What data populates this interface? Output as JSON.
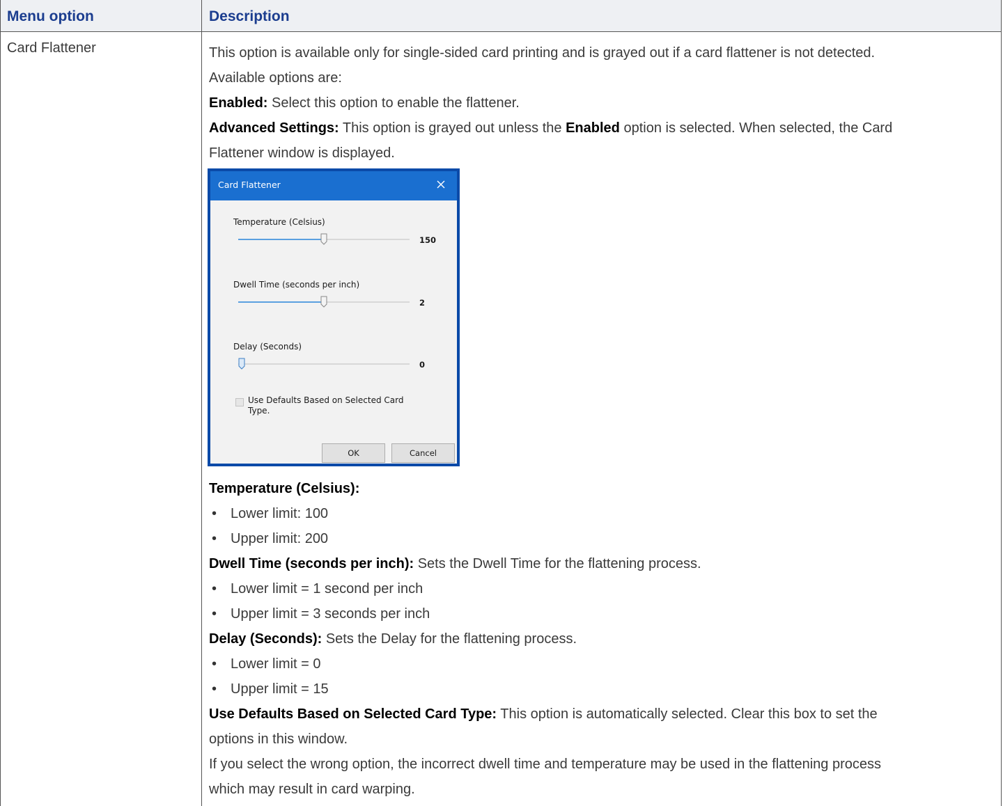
{
  "table": {
    "headers": [
      "Menu option",
      "Description"
    ],
    "row": {
      "option": "Card Flattener",
      "intro_1": "This option is available only for single-sided card printing and is grayed out if a card flattener is not detected.",
      "intro_2": "Available options are:",
      "enabled_term": "Enabled:",
      "enabled_text": " Select this option to enable the flattener.",
      "adv_term": "Advanced Settings:",
      "adv_text_1": " This option is grayed out unless the ",
      "adv_text_em": "Enabled",
      "adv_text_2": " option is selected. When selected, the Card",
      "adv_text_3": "Flattener window is displayed.",
      "temp_term": "Temperature (Celsius):",
      "temp_bullets": [
        "Lower limit: 100",
        "Upper limit: 200"
      ],
      "dwell_term": "Dwell Time (seconds per inch):",
      "dwell_text": " Sets the Dwell Time for the flattening process.",
      "dwell_bullets": [
        "Lower limit = 1 second per inch",
        "Upper limit = 3 seconds per inch"
      ],
      "delay_term": "Delay (Seconds):",
      "delay_text": " Sets the Delay for the flattening process.",
      "delay_bullets": [
        "Lower limit = 0",
        "Upper limit = 15"
      ],
      "defaults_term": "Use Defaults Based on Selected Card Type:",
      "defaults_text_1": " This option is automatically selected. Clear this box to set the",
      "defaults_text_2": "options in this window.",
      "warning_1": "If you select the wrong option, the incorrect dwell time and temperature may be used in the flattening process",
      "warning_2": "which may result in card warping."
    }
  },
  "dialog": {
    "title": "Card Flattener",
    "sliders": [
      {
        "label": "Temperature (Celsius)",
        "value": "150",
        "fill_fraction": 0.5
      },
      {
        "label": "Dwell Time (seconds per inch)",
        "value": "2",
        "fill_fraction": 0.5
      },
      {
        "label": "Delay (Seconds)",
        "value": "0",
        "fill_fraction": 0.0
      }
    ],
    "checkbox_label": "Use Defaults Based on Selected Card Type.",
    "checkbox_checked": false,
    "ok_label": "OK",
    "cancel_label": "Cancel"
  },
  "colors": {
    "header_text": "#1b3d8f",
    "header_bg": "#eef0f3",
    "dialog_border": "#0b4aa8",
    "dialog_titlebar": "#1a6fd0",
    "slider_fill": "#5aa0e0"
  }
}
